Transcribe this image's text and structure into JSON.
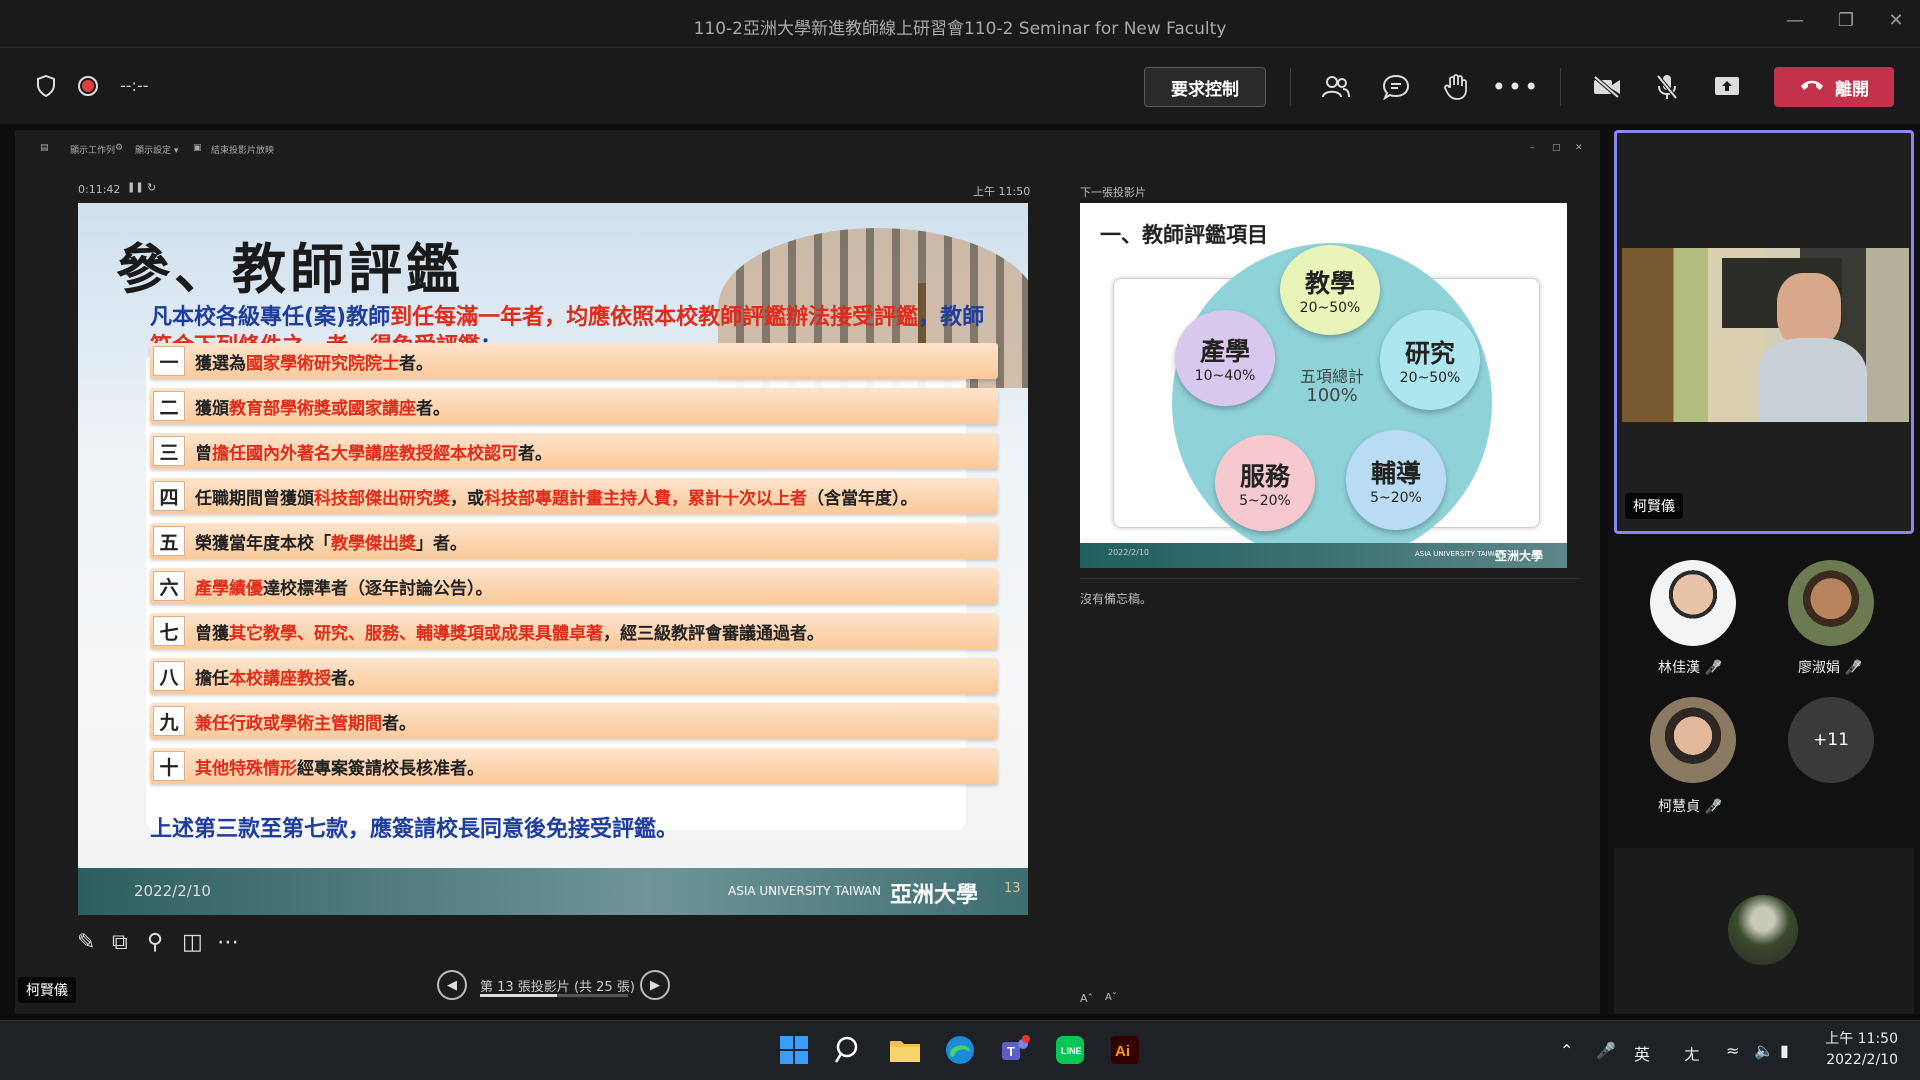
{
  "window": {
    "title": "110-2亞洲大學新進教師線上研習會110-2 Seminar for New Faculty"
  },
  "toolbar": {
    "timer": "--:--",
    "request_control": "要求控制",
    "leave": "離開",
    "accent": "#c4314b"
  },
  "presenter_view": {
    "menu": [
      "顯示工作列",
      "顯示設定 ▾",
      "結束投影片放映"
    ],
    "elapsed": "0:11:42",
    "clock": "上午 11:50",
    "next_slide_label": "下一張投影片",
    "notes": "沒有備忘稿。",
    "nav_text": "第 13 張投影片 (共 25 張)",
    "presenter_name": "柯賢儀",
    "progress": 0.52
  },
  "slide": {
    "title": "參、教師評鑑",
    "intro_a": "凡本校各級專任(案)教師",
    "intro_b": "到任每滿一年者，均應依照本校教師評鑑辦法接受評鑑",
    "intro_c": "，教師",
    "intro_d": "符合下列條件之一者，得免受評鑑",
    "intro_e": "：",
    "rows": [
      {
        "num": "一",
        "parts": [
          {
            "t": "獲選為",
            "r": false
          },
          {
            "t": "國家學術研究院院士",
            "r": true
          },
          {
            "t": "者。",
            "r": false
          }
        ]
      },
      {
        "num": "二",
        "parts": [
          {
            "t": "獲頒",
            "r": false
          },
          {
            "t": "教育部學術獎或國家講座",
            "r": true
          },
          {
            "t": "者。",
            "r": false
          }
        ]
      },
      {
        "num": "三",
        "parts": [
          {
            "t": "曾",
            "r": false
          },
          {
            "t": "擔任國內外著名大學講座教授經本校認可",
            "r": true
          },
          {
            "t": "者。",
            "r": false
          }
        ]
      },
      {
        "num": "四",
        "parts": [
          {
            "t": "任職期間曾獲頒",
            "r": false
          },
          {
            "t": "科技部傑出研究獎",
            "r": true
          },
          {
            "t": "，或",
            "r": false
          },
          {
            "t": "科技部專題計畫主持人費，累計十次以上者",
            "r": true
          },
          {
            "t": "（含當年度）。",
            "r": false
          }
        ]
      },
      {
        "num": "五",
        "parts": [
          {
            "t": "榮獲當年度本校「",
            "r": false
          },
          {
            "t": "教學傑出獎",
            "r": true
          },
          {
            "t": "」者。",
            "r": false
          }
        ]
      },
      {
        "num": "六",
        "parts": [
          {
            "t": "產學績優",
            "r": true
          },
          {
            "t": "達校標準者（逐年討論公告）。",
            "r": false
          }
        ]
      },
      {
        "num": "七",
        "parts": [
          {
            "t": "曾獲",
            "r": false
          },
          {
            "t": "其它教學、研究、服務、輔導獎項或成果具體卓著",
            "r": true
          },
          {
            "t": "，經三級教評會審議通過者。",
            "r": false
          }
        ]
      },
      {
        "num": "八",
        "parts": [
          {
            "t": "擔任",
            "r": false
          },
          {
            "t": "本校講座教授",
            "r": true
          },
          {
            "t": "者。",
            "r": false
          }
        ]
      },
      {
        "num": "九",
        "parts": [
          {
            "t": "兼任行政或學術主管期間",
            "r": true
          },
          {
            "t": "者。",
            "r": false
          }
        ]
      },
      {
        "num": "十",
        "parts": [
          {
            "t": "其他特殊情形",
            "r": true
          },
          {
            "t": "經專案簽請校長核准者。",
            "r": false
          }
        ]
      }
    ],
    "note": "上述第三款至第七款，應簽請校長同意後免接受評鑑。",
    "date": "2022/2/10",
    "univ_en": "ASIA UNIVERSITY TAIWAN",
    "univ_zh": "亞洲大學",
    "page": "13"
  },
  "next_slide": {
    "title": "一、教師評鑑項目",
    "center_label": "五項總計",
    "center_value": "100%",
    "items": [
      {
        "name": "教學",
        "range": "20~50%",
        "color": "#e9f4b8"
      },
      {
        "name": "研究",
        "range": "20~50%",
        "color": "#aee6ef"
      },
      {
        "name": "輔導",
        "range": "5~20%",
        "color": "#b9dcf2"
      },
      {
        "name": "服務",
        "range": "5~20%",
        "color": "#f6c9cf"
      },
      {
        "name": "產學",
        "range": "10~40%",
        "color": "#d8c8ee"
      }
    ],
    "date": "2022/2/10",
    "univ_en": "ASIA UNIVERSITY TAIWAN",
    "univ_zh": "亞洲大學"
  },
  "participants": {
    "self": "柯賢儀",
    "others": [
      {
        "name": "林佳漢",
        "muted": true
      },
      {
        "name": "廖淑娟",
        "muted": true
      },
      {
        "name": "柯慧貞",
        "muted": true
      }
    ],
    "overflow": "+11"
  },
  "taskbar": {
    "ime": "英",
    "time": "上午 11:50",
    "date": "2022/2/10",
    "apps": [
      "windows-start",
      "search",
      "file-explorer",
      "edge",
      "teams",
      "line",
      "illustrator"
    ]
  }
}
